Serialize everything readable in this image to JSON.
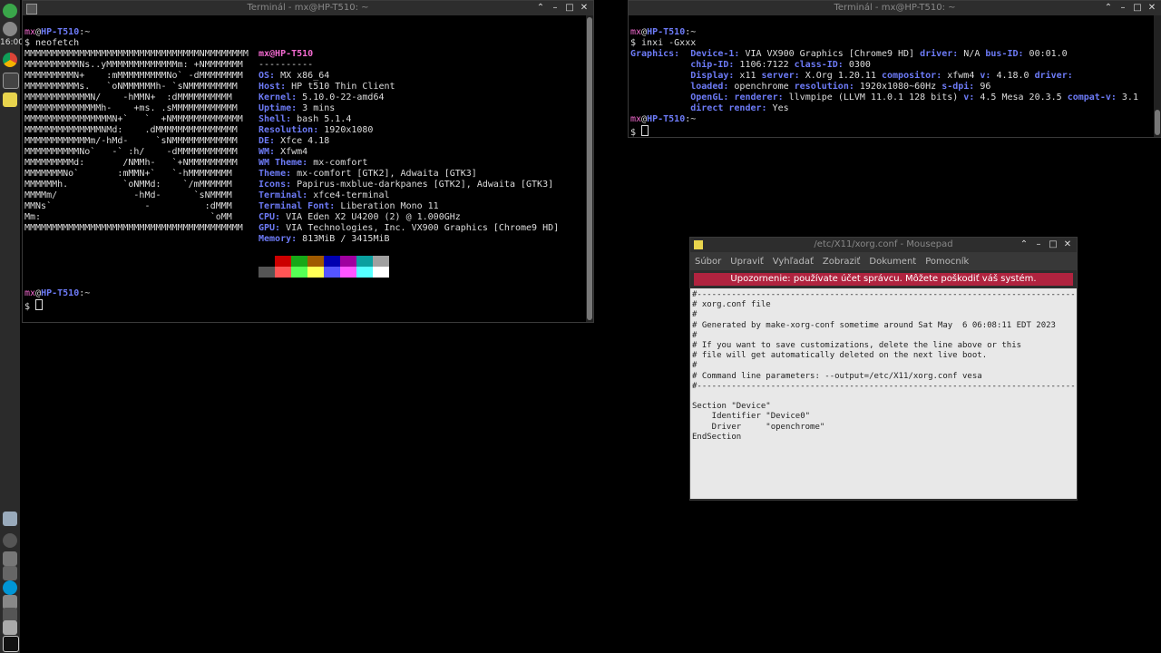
{
  "panel": {
    "clock": "16:00"
  },
  "term1": {
    "title": "Terminál - mx@HP-T510: ~",
    "prompt_user": "mx",
    "prompt_at": "@",
    "prompt_host": "HP-T510",
    "prompt_path": ":~",
    "command": "$ neofetch",
    "logo": [
      "MMMMMMMMMMMMMMMMMMMMMMMMMMMMMMMMNMMMMMMMM",
      "MMMMMMMMMMNs..yMMMMMMMMMMMMMm: +NMMMMMMM",
      "MMMMMMMMMN+    :mMMMMMMMMMNo` -dMMMMMMMM",
      "MMMMMMMMMMs.   `oNMMMMMMh- `sNMMMMMMMMM",
      "MMMMMMMMMMMMN/    -hMMN+  :dMMMMMMMMMM",
      "MMMMMMMMMMMMMMh-    +ms. .sMMMMMMMMMMMM",
      "MMMMMMMMMMMMMMMMN+`   `  +NMMMMMMMMMMMMM",
      "MMMMMMMMMMMMMMNMd:    .dMMMMMMMMMMMMMMM",
      "MMMMMMMMMMMMm/-hMd-     `sNMMMMMMMMMMMM",
      "MMMMMMMMMMNo`   -` :h/    -dMMMMMMMMMMM",
      "MMMMMMMMMd:       /NMMh-   `+NMMMMMMMMM",
      "MMMMMMMNo`       :mMMN+`   `-hMMMMMMMM",
      "MMMMMMh.          `oNMMd:    `/mMMMMMM",
      "MMMMm/              -hMd-      `sNMMMM",
      "MMNs`                 -          :dMMM",
      "Mm:                               `oMM",
      "MMMMMMMMMMMMMMMMMMMMMMMMMMMMMMMMMMMMMMMM"
    ],
    "info_user": "mx@HP-T510",
    "info_sep": "----------",
    "info": [
      {
        "k": "OS",
        "v": "MX x86_64"
      },
      {
        "k": "Host",
        "v": "HP t510 Thin Client"
      },
      {
        "k": "Kernel",
        "v": "5.10.0-22-amd64"
      },
      {
        "k": "Uptime",
        "v": "3 mins"
      },
      {
        "k": "Shell",
        "v": "bash 5.1.4"
      },
      {
        "k": "Resolution",
        "v": "1920x1080"
      },
      {
        "k": "DE",
        "v": "Xfce 4.18"
      },
      {
        "k": "WM",
        "v": "Xfwm4"
      },
      {
        "k": "WM Theme",
        "v": "mx-comfort"
      },
      {
        "k": "Theme",
        "v": "mx-comfort [GTK2], Adwaita [GTK3]"
      },
      {
        "k": "Icons",
        "v": "Papirus-mxblue-darkpanes [GTK2], Adwaita [GTK3]"
      },
      {
        "k": "Terminal",
        "v": "xfce4-terminal"
      },
      {
        "k": "Terminal Font",
        "v": "Liberation Mono 11"
      },
      {
        "k": "CPU",
        "v": "VIA Eden X2 U4200 (2) @ 1.000GHz"
      },
      {
        "k": "GPU",
        "v": "VIA Technologies, Inc. VX900 Graphics [Chrome9 HD]"
      },
      {
        "k": "Memory",
        "v": "813MiB / 3415MiB"
      }
    ],
    "colors_row1": [
      "#000000",
      "#cc0000",
      "#17a817",
      "#a05a00",
      "#0000b0",
      "#a000a0",
      "#0aa0a0",
      "#a0a0a0"
    ],
    "colors_row2": [
      "#555555",
      "#ff5555",
      "#55ff55",
      "#ffff55",
      "#5555ff",
      "#ff55ff",
      "#55ffff",
      "#ffffff"
    ],
    "final_prompt": "$"
  },
  "term2": {
    "title": "Terminál - mx@HP-T510: ~",
    "command": "$ inxi -Gxxx",
    "lines": [
      [
        {
          "t": "Graphics:",
          "c": "lbl"
        },
        {
          "t": "  "
        },
        {
          "t": "Device-1:",
          "c": "lbl"
        },
        {
          "t": " VIA VX900 Graphics [Chrome9 HD] "
        },
        {
          "t": "driver:",
          "c": "lbl"
        },
        {
          "t": " N/A "
        },
        {
          "t": "bus-ID:",
          "c": "lbl"
        },
        {
          "t": " 00:01.0"
        }
      ],
      [
        {
          "t": "           "
        },
        {
          "t": "chip-ID:",
          "c": "lbl"
        },
        {
          "t": " 1106:7122 "
        },
        {
          "t": "class-ID:",
          "c": "lbl"
        },
        {
          "t": " 0300"
        }
      ],
      [
        {
          "t": "           "
        },
        {
          "t": "Display:",
          "c": "lbl"
        },
        {
          "t": " x11 "
        },
        {
          "t": "server:",
          "c": "lbl"
        },
        {
          "t": " X.Org 1.20.11 "
        },
        {
          "t": "compositor:",
          "c": "lbl"
        },
        {
          "t": " xfwm4 "
        },
        {
          "t": "v:",
          "c": "lbl"
        },
        {
          "t": " 4.18.0 "
        },
        {
          "t": "driver:",
          "c": "lbl"
        }
      ],
      [
        {
          "t": "           "
        },
        {
          "t": "loaded:",
          "c": "lbl"
        },
        {
          "t": " openchrome "
        },
        {
          "t": "resolution:",
          "c": "lbl"
        },
        {
          "t": " 1920x1080~60Hz "
        },
        {
          "t": "s-dpi:",
          "c": "lbl"
        },
        {
          "t": " 96"
        }
      ],
      [
        {
          "t": "           "
        },
        {
          "t": "OpenGL:",
          "c": "lbl"
        },
        {
          "t": " "
        },
        {
          "t": "renderer:",
          "c": "lbl"
        },
        {
          "t": " llvmpipe (LLVM 11.0.1 128 bits) "
        },
        {
          "t": "v:",
          "c": "lbl"
        },
        {
          "t": " 4.5 Mesa 20.3.5 "
        },
        {
          "t": "compat-v:",
          "c": "lbl"
        },
        {
          "t": " 3.1"
        }
      ],
      [
        {
          "t": "           "
        },
        {
          "t": "direct render:",
          "c": "lbl"
        },
        {
          "t": " Yes"
        }
      ]
    ]
  },
  "mousepad": {
    "title": "/etc/X11/xorg.conf - Mousepad",
    "menu": [
      "Súbor",
      "Upraviť",
      "Vyhľadať",
      "Zobraziť",
      "Dokument",
      "Pomocník"
    ],
    "warning": "Upozornenie: používate účet správcu. Môžete poškodiť váš systém.",
    "content": "#-------------------------------------------------------------------------------\n# xorg.conf file\n#\n# Generated by make-xorg-conf sometime around Sat May  6 06:08:11 EDT 2023\n#\n# If you want to save customizations, delete the line above or this\n# file will get automatically deleted on the next live boot.\n#\n# Command line parameters: --output=/etc/X11/xorg.conf vesa\n#-------------------------------------------------------------------------------\n\nSection \"Device\"\n    Identifier \"Device0\"\n    Driver     \"openchrome\"\nEndSection"
  },
  "window_buttons": {
    "up": "⌃",
    "min": "–",
    "max": "□",
    "close": "✕"
  }
}
